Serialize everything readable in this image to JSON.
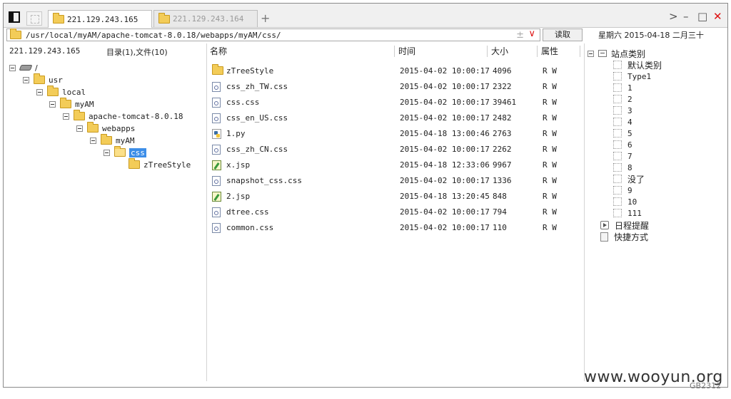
{
  "tabs": [
    {
      "label": "221.129.243.165",
      "active": true
    },
    {
      "label": "221.129.243.164",
      "active": false
    }
  ],
  "tabbar": {
    "new_tab": "+"
  },
  "window_controls": {
    "forward": ">",
    "minimize": "–",
    "maximize": "□",
    "close": "✕"
  },
  "address": {
    "path": "/usr/local/myAM/apache-tomcat-8.0.18/webapps/myAM/css/",
    "plusminus": "±",
    "dropdown": "∨",
    "read_button": "读取"
  },
  "date_display": "星期六 2015-04-18 二月三十",
  "left_pane": {
    "host": "221.129.243.165",
    "counts": "目录(1),文件(10)",
    "tree": [
      {
        "label": "/",
        "icon": "drive-icon"
      },
      {
        "label": "usr",
        "icon": "folder-icon"
      },
      {
        "label": "local",
        "icon": "folder-icon"
      },
      {
        "label": "myAM",
        "icon": "folder-icon"
      },
      {
        "label": "apache-tomcat-8.0.18",
        "icon": "folder-icon"
      },
      {
        "label": "webapps",
        "icon": "folder-icon"
      },
      {
        "label": "myAM",
        "icon": "folder-icon"
      },
      {
        "label": "css",
        "icon": "folder-open-icon",
        "selected": true
      },
      {
        "label": "zTreeStyle",
        "icon": "folder-icon"
      }
    ]
  },
  "file_list": {
    "columns": {
      "name": "名称",
      "time": "时间",
      "size": "大小",
      "attr": "属性"
    },
    "rows": [
      {
        "name": "zTreeStyle",
        "time": "2015-04-02 10:00:17",
        "size": "4096",
        "attr": "R W",
        "icon": "folder-icon"
      },
      {
        "name": "css_zh_TW.css",
        "time": "2015-04-02 10:00:17",
        "size": "2322",
        "attr": "R W",
        "icon": "css-file-icon"
      },
      {
        "name": "css.css",
        "time": "2015-04-02 10:00:17",
        "size": "39461",
        "attr": "R W",
        "icon": "css-file-icon"
      },
      {
        "name": "css_en_US.css",
        "time": "2015-04-02 10:00:17",
        "size": "2482",
        "attr": "R W",
        "icon": "css-file-icon"
      },
      {
        "name": "1.py",
        "time": "2015-04-18 13:00:46",
        "size": "2763",
        "attr": "R W",
        "icon": "python-file-icon"
      },
      {
        "name": "css_zh_CN.css",
        "time": "2015-04-02 10:00:17",
        "size": "2262",
        "attr": "R W",
        "icon": "css-file-icon"
      },
      {
        "name": "x.jsp",
        "time": "2015-04-18 12:33:06",
        "size": "9967",
        "attr": "R W",
        "icon": "jsp-file-icon"
      },
      {
        "name": "snapshot_css.css",
        "time": "2015-04-02 10:00:17",
        "size": "1336",
        "attr": "R W",
        "icon": "css-file-icon"
      },
      {
        "name": "2.jsp",
        "time": "2015-04-18 13:20:45",
        "size": "848",
        "attr": "R W",
        "icon": "jsp-file-icon"
      },
      {
        "name": "dtree.css",
        "time": "2015-04-02 10:00:17",
        "size": "794",
        "attr": "R W",
        "icon": "css-file-icon"
      },
      {
        "name": "common.css",
        "time": "2015-04-02 10:00:17",
        "size": "110",
        "attr": "R W",
        "icon": "css-file-icon"
      }
    ]
  },
  "right_pane": {
    "site_category": "站点类别",
    "categories": [
      "默认类别",
      "Type1",
      "1",
      "2",
      "3",
      "4",
      "5",
      "6",
      "7",
      "8",
      "没了",
      "9",
      "10",
      "111"
    ],
    "schedule": "日程提醒",
    "shortcuts": "快捷方式"
  },
  "bottom": {
    "watermark": "www.wooyun.org",
    "encoding": "GB2312"
  }
}
